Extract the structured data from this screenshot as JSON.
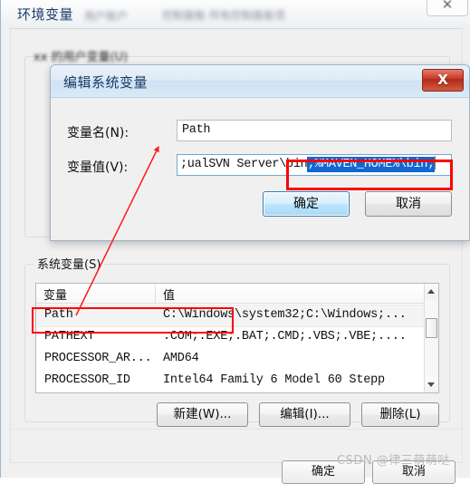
{
  "outer_window": {
    "title": "环境变量",
    "blurred_title_text_1": "用户账户",
    "blurred_title_text_2": "控制面板 所有控制面板项",
    "close_label": "✕",
    "user_group_label": "xx 的用户变量(U)",
    "system_group_label": "系统变量(S)",
    "list": {
      "columns": [
        "变量",
        "值"
      ],
      "rows": [
        {
          "name": "Path",
          "value": "C:\\Windows\\system32;C:\\Windows;...",
          "selected": true
        },
        {
          "name": "PATHEXT",
          "value": ".COM;.EXE;.BAT;.CMD;.VBS;.VBE;....",
          "selected": false
        },
        {
          "name": "PROCESSOR_AR...",
          "value": "AMD64",
          "selected": false
        },
        {
          "name": "PROCESSOR_ID",
          "value": "Intel64 Family 6 Model 60 Stepp",
          "selected": false
        }
      ]
    },
    "buttons": {
      "new": "新建(W)...",
      "edit": "编辑(I)...",
      "delete": "删除(L)"
    },
    "footer_buttons": {
      "ok": "确定",
      "cancel": "取消"
    }
  },
  "edit_dialog": {
    "title": "编辑系统变量",
    "close_label": "X",
    "fields": {
      "name_label": "变量名(N):",
      "name_value": "Path",
      "value_label": "变量值(V):",
      "value_prefix": ";ualSVN Server\\bin",
      "value_selected": ";%MAVEN_HOME%\\bin;"
    },
    "buttons": {
      "ok": "确定",
      "cancel": "取消"
    }
  },
  "annotations": {
    "highlight_color": "#ff0000",
    "arrow_from": "系统变量列表 Path 行",
    "arrow_to": "变量名输入框"
  },
  "watermark": "CSDN @律三萌萌哒"
}
